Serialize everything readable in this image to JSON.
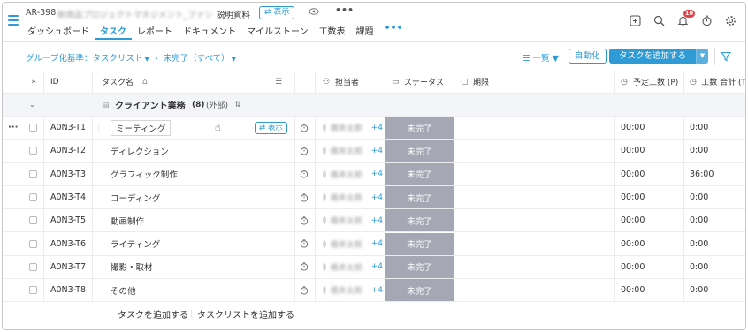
{
  "header": {
    "project_id": "AR-398",
    "project_name": "新商品プロジェクトマネジメント_ファン",
    "doc_label": "説明資料",
    "show_label": "⇄ 表示",
    "more_label": "•••",
    "notification_count": "10"
  },
  "tabs": [
    {
      "label": "ダッシュボード",
      "active": false
    },
    {
      "label": "タスク",
      "active": true
    },
    {
      "label": "レポート",
      "active": false
    },
    {
      "label": "ドキュメント",
      "active": false
    },
    {
      "label": "マイルストーン",
      "active": false
    },
    {
      "label": "工数表",
      "active": false
    },
    {
      "label": "課題",
      "active": false
    }
  ],
  "tabs_more": "•••",
  "filterbar": {
    "group_by": "グループ化基準：タスクリスト",
    "filter": "未完了（すべて）",
    "view": "一覧",
    "automation": "自動化",
    "add_task": "タスクを追加する"
  },
  "columns": {
    "id": "ID",
    "task_name": "タスク名",
    "assignee": "担当者",
    "status": "ステータス",
    "due": "期限",
    "planned_hours": "予定工数 (P)",
    "total_hours": "工数 合計 (T"
  },
  "group": {
    "name": "クライアント業務",
    "count": "(8)",
    "scope": "(外部)"
  },
  "rows": [
    {
      "id": "A0N3-T1",
      "name": "ミーティング",
      "assignee": "橋本太郎",
      "plus": "+4",
      "status": "未完了",
      "planned": "00:00",
      "total": "0:00",
      "show": "⇄ 表示"
    },
    {
      "id": "A0N3-T2",
      "name": "ディレクション",
      "assignee": "橋本太郎",
      "plus": "+4",
      "status": "未完了",
      "planned": "00:00",
      "total": "0:00"
    },
    {
      "id": "A0N3-T3",
      "name": "グラフィック制作",
      "assignee": "橋本太郎",
      "plus": "+4",
      "status": "未完了",
      "planned": "00:00",
      "total": "36:00"
    },
    {
      "id": "A0N3-T4",
      "name": "コーディング",
      "assignee": "橋本太郎",
      "plus": "+4",
      "status": "未完了",
      "planned": "00:00",
      "total": "0:00"
    },
    {
      "id": "A0N3-T5",
      "name": "動画制作",
      "assignee": "橋本太郎",
      "plus": "+4",
      "status": "未完了",
      "planned": "00:00",
      "total": "0:00"
    },
    {
      "id": "A0N3-T6",
      "name": "ライティング",
      "assignee": "橋本太郎",
      "plus": "+4",
      "status": "未完了",
      "planned": "00:00",
      "total": "0:00"
    },
    {
      "id": "A0N3-T7",
      "name": "撮影・取材",
      "assignee": "橋本太郎",
      "plus": "+4",
      "status": "未完了",
      "planned": "00:00",
      "total": "0:00"
    },
    {
      "id": "A0N3-T8",
      "name": "その他",
      "assignee": "橋本太郎",
      "plus": "+4",
      "status": "未完了",
      "planned": "00:00",
      "total": "0:00"
    }
  ],
  "footer": {
    "add_task": "タスクを追加する",
    "add_tasklist": "タスクリストを追加する"
  },
  "colors": {
    "accent": "#2e9bd6",
    "status_bg": "#a5a7b5",
    "badge": "#e0454b"
  },
  "icons": [
    "menu-icon",
    "eye-icon",
    "add-square-icon",
    "search-icon",
    "bell-icon",
    "timer-icon",
    "gear-icon",
    "filter-icon",
    "clock-icon",
    "cursor-icon"
  ]
}
